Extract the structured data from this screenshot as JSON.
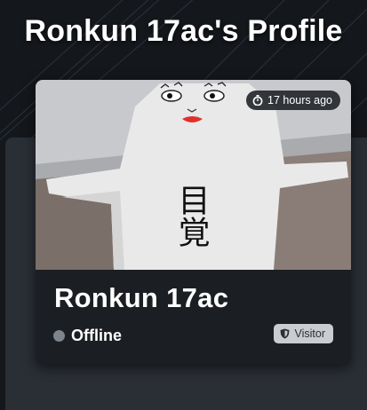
{
  "page": {
    "title": "Ronkun 17ac's Profile"
  },
  "profile": {
    "display_name": "Ronkun 17ac",
    "status": {
      "label": "Offline",
      "dot_color": "#7d848c"
    },
    "last_seen": {
      "label": "17 hours ago",
      "icon": "stopwatch-icon"
    },
    "trust_rank": {
      "label": "Visitor",
      "icon": "shield-icon"
    },
    "avatar_thumbnail": {
      "sign_text": "目覚"
    }
  },
  "colors": {
    "background": "#14171b",
    "panel": "#2a2f35",
    "card": "#1b1e22",
    "badge_dark": "#24272c",
    "badge_light": "#c9ccd0"
  }
}
